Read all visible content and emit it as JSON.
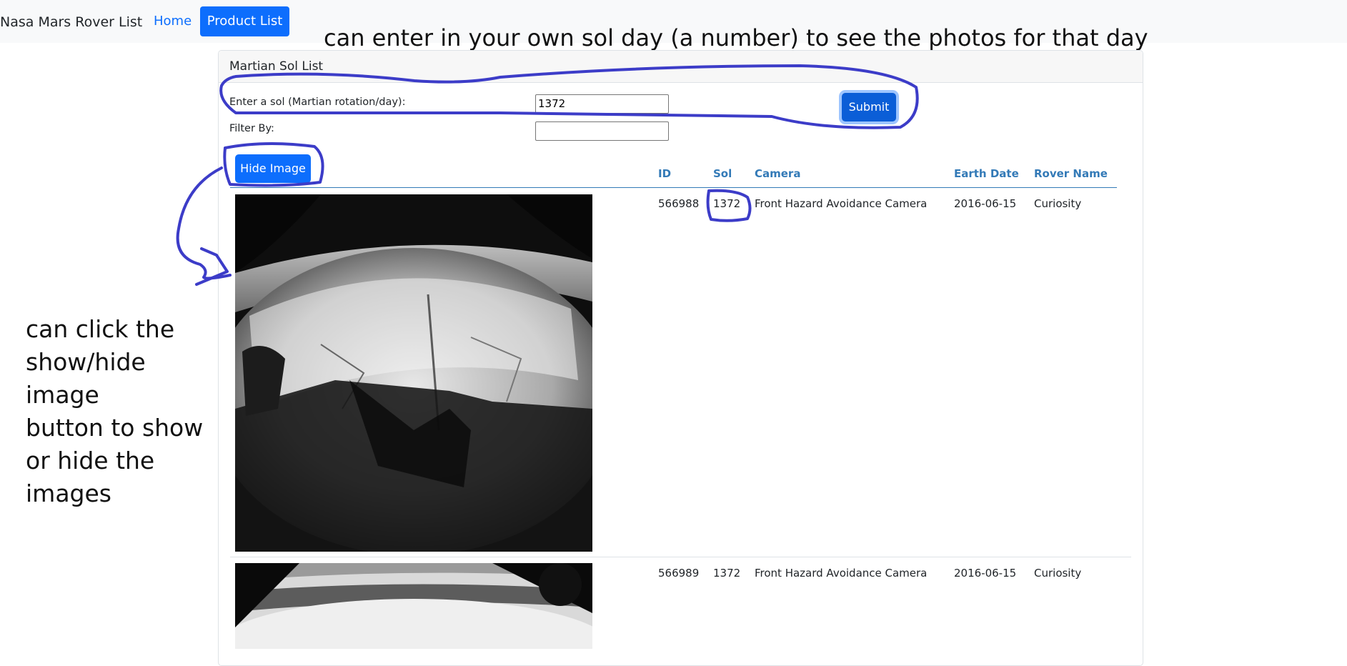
{
  "navbar": {
    "brand": "Nasa Mars Rover List",
    "links": [
      "Home",
      "Product List"
    ],
    "active": "Product List"
  },
  "annotations": {
    "top": "can enter in your own sol day (a number) to see the photos for that day",
    "left_lines": [
      "can click the",
      "show/hide image",
      "button to show",
      "or hide the",
      "images"
    ],
    "pen_color": "#3c3cc8"
  },
  "card": {
    "title": "Martian Sol List"
  },
  "form": {
    "sol_label": "Enter a sol (Martian rotation/day):",
    "sol_value": "1372",
    "filter_label": "Filter By:",
    "filter_value": "",
    "submit_label": "Submit",
    "toggle_label": "Hide Image"
  },
  "table": {
    "headers": [
      "ID",
      "Sol",
      "Camera",
      "Earth Date",
      "Rover Name"
    ],
    "rows": [
      {
        "id": "566988",
        "sol": "1372",
        "camera": "Front Hazard Avoidance Camera",
        "earth_date": "2016-06-15",
        "rover": "Curiosity"
      },
      {
        "id": "566989",
        "sol": "1372",
        "camera": "Front Hazard Avoidance Camera",
        "earth_date": "2016-06-15",
        "rover": "Curiosity"
      }
    ]
  },
  "colors": {
    "primary": "#0d6efd",
    "header_text": "#337ab7"
  }
}
